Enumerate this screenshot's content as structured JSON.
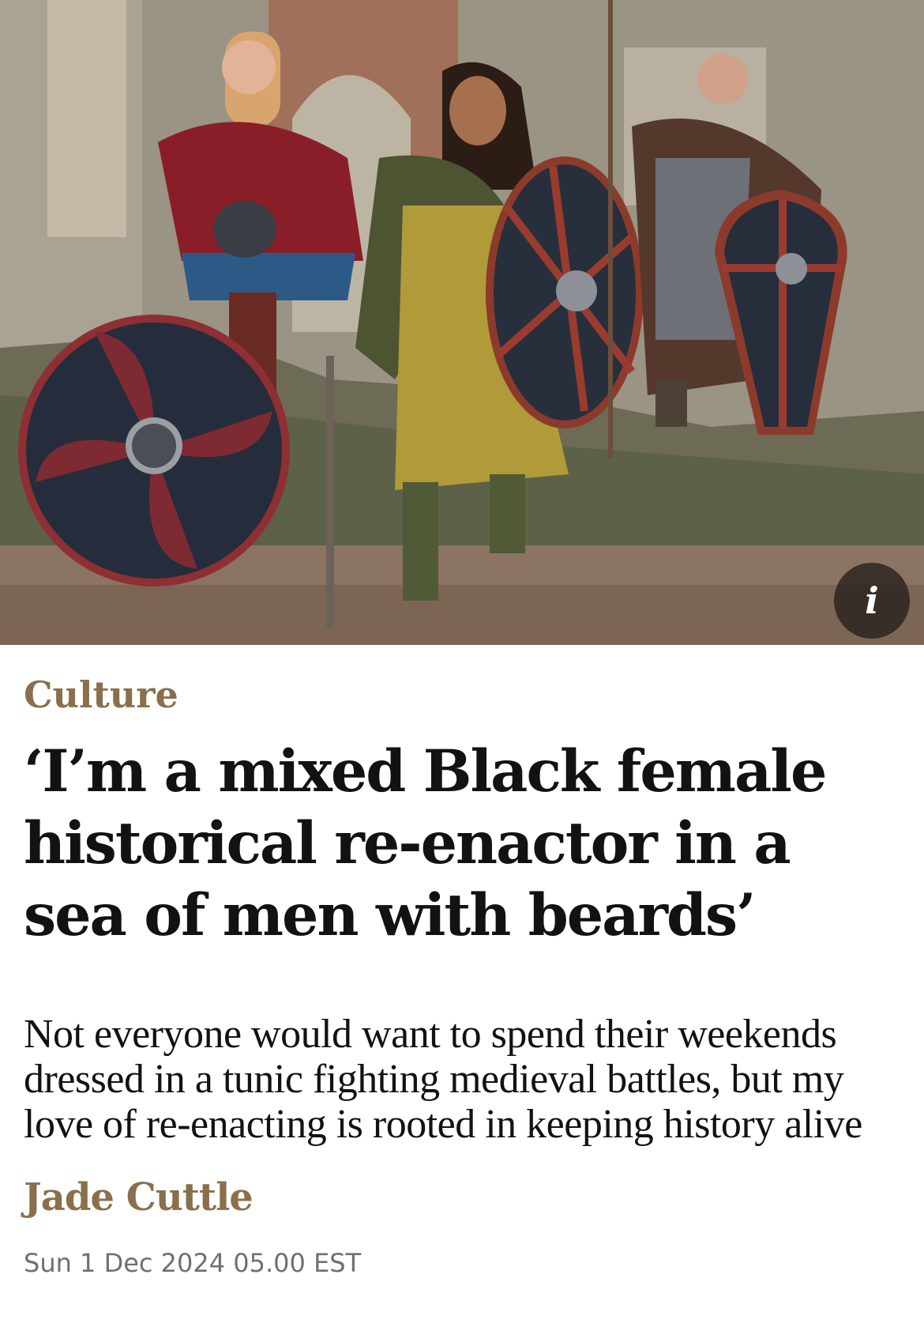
{
  "article": {
    "section": "Culture",
    "headline": "‘I’m a mixed Black female historical re-enactor in a sea of men with beards’",
    "standfirst": "Not everyone would want to spend their weekends dressed in a tunic fighting medieval battles, but my love of re-enacting is rooted in keeping history alive",
    "byline": "Jade Cuttle",
    "dateline": "Sun 1 Dec 2024 05.00 EST"
  },
  "hero": {
    "info_button_label": "i",
    "info_icon": "info-icon"
  },
  "colors": {
    "section_accent": "#8a6f4c",
    "headline_text": "#121212",
    "dateline_text": "#707070"
  }
}
